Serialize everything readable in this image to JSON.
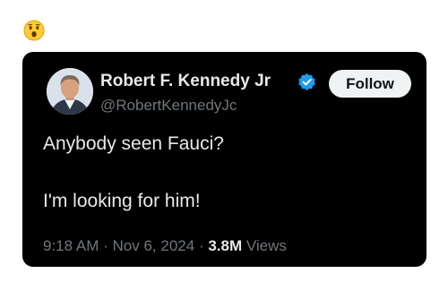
{
  "reaction": {
    "emoji": "😲",
    "icon": "astonished-face-icon"
  },
  "tweet": {
    "display_name": "Robert F. Kennedy Jr",
    "handle": "@RobertKennedyJc",
    "follow_label": "Follow",
    "verified_icon": "verified-badge-icon",
    "verified_color": "#1d9bf0",
    "text_line1": "Anybody seen Fauci?",
    "text_line2": "I'm looking for him!",
    "time": "9:18 AM",
    "separator": "·",
    "date": "Nov 6, 2024",
    "views_count": "3.8M",
    "views_label": "Views"
  },
  "colors": {
    "card_background": "#000000",
    "primary_text": "#e7e9ea",
    "secondary_text": "#71767b",
    "follow_background": "#eff3f4",
    "follow_text": "#0f1419"
  }
}
